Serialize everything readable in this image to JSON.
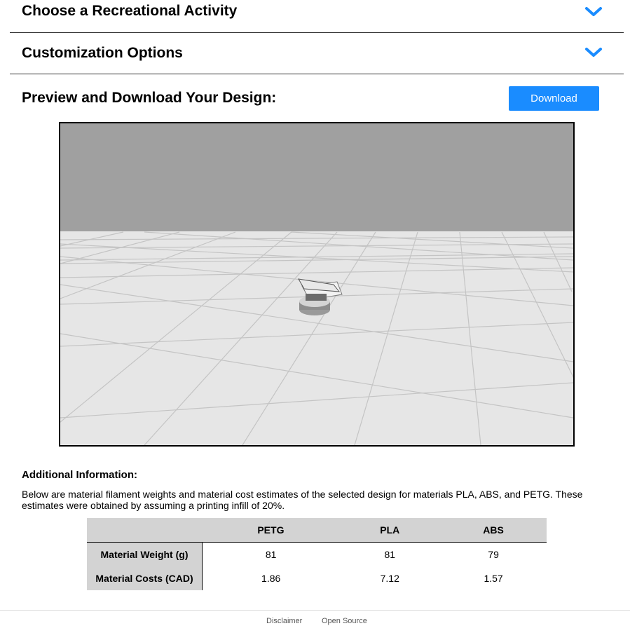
{
  "sections": {
    "recreational_activity": {
      "title": "Choose a Recreational Activity"
    },
    "customization": {
      "title": "Customization Options"
    }
  },
  "preview": {
    "title": "Preview and Download Your Design:",
    "download_label": "Download"
  },
  "colors": {
    "accent": "#1a8cff",
    "chevron": "#1a8cff",
    "viewer_sky": "#a0a0a0",
    "viewer_floor": "#e6e6e6",
    "table_header": "#d3d3d3"
  },
  "additional_info": {
    "heading": "Additional Information:",
    "text": "Below are material filament weights and material cost estimates of the selected design for materials PLA, ABS, and PETG. These estimates were obtained by assuming a printing infill of 20%.",
    "table": {
      "columns": [
        "",
        "PETG",
        "PLA",
        "ABS"
      ],
      "rows": [
        {
          "label": "Material Weight (g)",
          "values": [
            "81",
            "81",
            "79"
          ]
        },
        {
          "label": "Material Costs (CAD)",
          "values": [
            "1.86",
            "7.12",
            "1.57"
          ]
        }
      ]
    }
  },
  "footer": {
    "links": [
      "Disclaimer",
      "Open Source"
    ]
  }
}
